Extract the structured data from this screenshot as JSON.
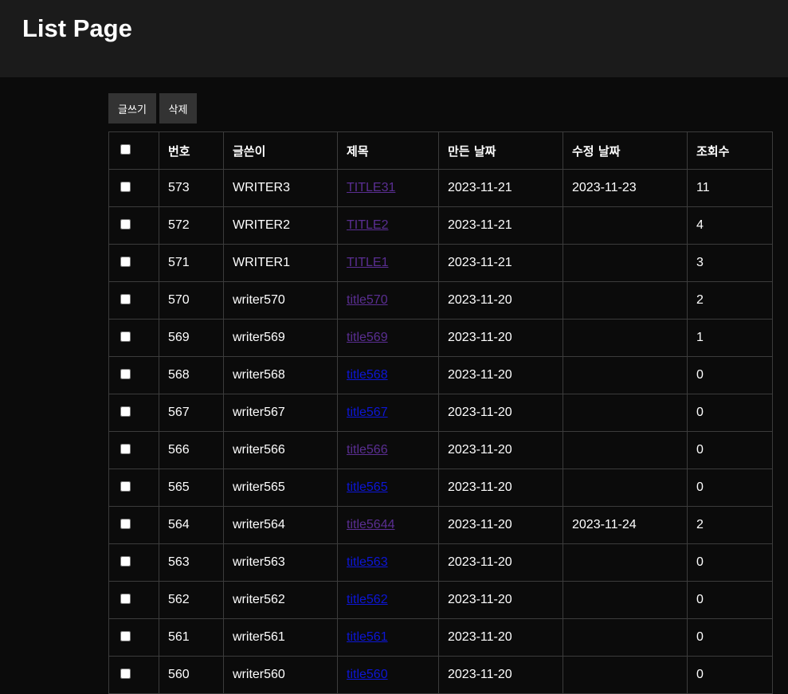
{
  "header": {
    "title": "List Page"
  },
  "toolbar": {
    "write_label": "글쓰기",
    "delete_label": "삭제"
  },
  "table": {
    "columns": [
      "번호",
      "글쓴이",
      "제목",
      "만든 날짜",
      "수정 날짜",
      "조회수"
    ],
    "rows": [
      {
        "no": "573",
        "writer": "WRITER3",
        "title": "TITLE31",
        "created": "2023-11-21",
        "modified": "2023-11-23",
        "views": "11",
        "visited": true
      },
      {
        "no": "572",
        "writer": "WRITER2",
        "title": "TITLE2",
        "created": "2023-11-21",
        "modified": "",
        "views": "4",
        "visited": true
      },
      {
        "no": "571",
        "writer": "WRITER1",
        "title": "TITLE1",
        "created": "2023-11-21",
        "modified": "",
        "views": "3",
        "visited": true
      },
      {
        "no": "570",
        "writer": "writer570",
        "title": "title570",
        "created": "2023-11-20",
        "modified": "",
        "views": "2",
        "visited": true
      },
      {
        "no": "569",
        "writer": "writer569",
        "title": "title569",
        "created": "2023-11-20",
        "modified": "",
        "views": "1",
        "visited": true
      },
      {
        "no": "568",
        "writer": "writer568",
        "title": "title568",
        "created": "2023-11-20",
        "modified": "",
        "views": "0",
        "visited": false
      },
      {
        "no": "567",
        "writer": "writer567",
        "title": "title567",
        "created": "2023-11-20",
        "modified": "",
        "views": "0",
        "visited": false
      },
      {
        "no": "566",
        "writer": "writer566",
        "title": "title566",
        "created": "2023-11-20",
        "modified": "",
        "views": "0",
        "visited": true
      },
      {
        "no": "565",
        "writer": "writer565",
        "title": "title565",
        "created": "2023-11-20",
        "modified": "",
        "views": "0",
        "visited": false
      },
      {
        "no": "564",
        "writer": "writer564",
        "title": "title5644",
        "created": "2023-11-20",
        "modified": "2023-11-24",
        "views": "2",
        "visited": true
      },
      {
        "no": "563",
        "writer": "writer563",
        "title": "title563",
        "created": "2023-11-20",
        "modified": "",
        "views": "0",
        "visited": false
      },
      {
        "no": "562",
        "writer": "writer562",
        "title": "title562",
        "created": "2023-11-20",
        "modified": "",
        "views": "0",
        "visited": false
      },
      {
        "no": "561",
        "writer": "writer561",
        "title": "title561",
        "created": "2023-11-20",
        "modified": "",
        "views": "0",
        "visited": false
      },
      {
        "no": "560",
        "writer": "writer560",
        "title": "title560",
        "created": "2023-11-20",
        "modified": "",
        "views": "0",
        "visited": false
      }
    ]
  }
}
